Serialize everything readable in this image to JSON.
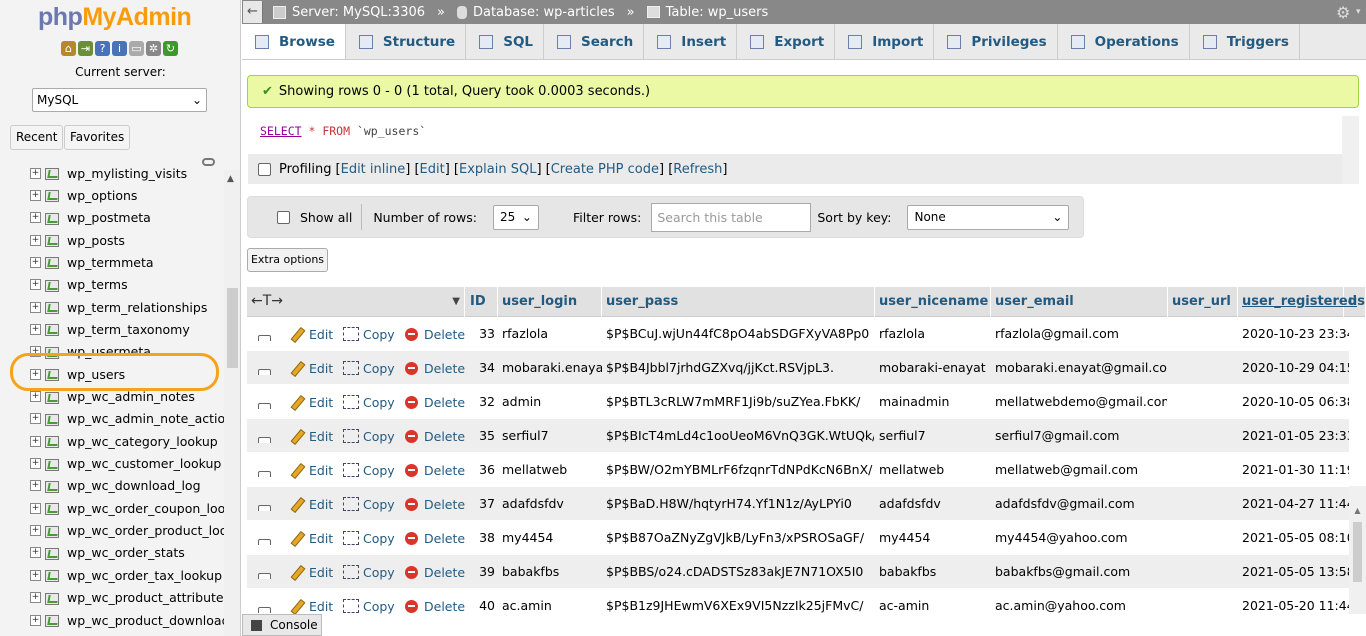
{
  "sidebar": {
    "logo_php": "php",
    "logo_my": "MyAdmin",
    "current_server_label": "Current server:",
    "server_select": "MySQL",
    "recent": "Recent",
    "favorites": "Favorites",
    "tables": [
      "wp_mylisting_visits",
      "wp_options",
      "wp_postmeta",
      "wp_posts",
      "wp_termmeta",
      "wp_terms",
      "wp_term_relationships",
      "wp_term_taxonomy",
      "wp_usermeta",
      "wp_users",
      "wp_wc_admin_notes",
      "wp_wc_admin_note_action",
      "wp_wc_category_lookup",
      "wp_wc_customer_lookup",
      "wp_wc_download_log",
      "wp_wc_order_coupon_look",
      "wp_wc_order_product_look",
      "wp_wc_order_stats",
      "wp_wc_order_tax_lookup",
      "wp_wc_product_attributes_",
      "wp_wc_product_download_"
    ]
  },
  "breadcrumb": {
    "server": "Server: MySQL:3306",
    "database": "Database: wp-articles",
    "table": "Table: wp_users"
  },
  "tabs": [
    "Browse",
    "Structure",
    "SQL",
    "Search",
    "Insert",
    "Export",
    "Import",
    "Privileges",
    "Operations",
    "Triggers"
  ],
  "success_message": "Showing rows 0 - 0 (1 total, Query took 0.0003 seconds.)",
  "sql": {
    "keyword": "SELECT",
    "rest": " * FROM ",
    "table": "`wp_users`"
  },
  "profiling": {
    "label": "Profiling",
    "edit_inline": "Edit inline",
    "edit": "Edit",
    "explain": "Explain SQL",
    "create_php": "Create PHP code",
    "refresh": "Refresh"
  },
  "navbar": {
    "show_all": "Show all",
    "num_rows_label": "Number of rows:",
    "num_rows_value": "25",
    "filter_label": "Filter rows:",
    "filter_placeholder": "Search this table",
    "sort_label": "Sort by key:",
    "sort_value": "None"
  },
  "extra_options": "Extra options",
  "columns": [
    "ID",
    "user_login",
    "user_pass",
    "user_nicename",
    "user_email",
    "user_url",
    "user_registered",
    "user_"
  ],
  "column_arrows": "←T→",
  "actions": {
    "edit": "Edit",
    "copy": "Copy",
    "delete": "Delete"
  },
  "rows": [
    {
      "id": "33",
      "login": "rfazlola",
      "pass": "$P$BCuJ.wjUn44fC8pO4abSDGFXyVA8Pp0",
      "nicename": "rfazlola",
      "email": "rfazlola@gmail.com",
      "url": "",
      "registered": "2020-10-23 23:34:0"
    },
    {
      "id": "34",
      "login": "mobaraki.enayat",
      "pass": "$P$B4Jbbl7jrhdGZXvq/jjKct.RSVjpL3.",
      "nicename": "mobaraki-enayat",
      "email": "mobaraki.enayat@gmail.com",
      "url": "",
      "registered": "2020-10-29 04:15:5"
    },
    {
      "id": "32",
      "login": "admin",
      "pass": "$P$BTL3cRLW7mMRF1Ji9b/suZYea.FbKK/",
      "nicename": "mainadmin",
      "email": "mellatwebdemo@gmail.com",
      "url": "",
      "registered": "2020-10-05 06:38:3"
    },
    {
      "id": "35",
      "login": "serfiul7",
      "pass": "$P$BIcT4mLd4c1ooUeoM6VnQ3GK.WtUQk/",
      "nicename": "serfiul7",
      "email": "serfiul7@gmail.com",
      "url": "",
      "registered": "2021-01-05 23:33:2"
    },
    {
      "id": "36",
      "login": "mellatweb",
      "pass": "$P$BW/O2mYBMLrF6fzqnrTdNPdKcN6BnX/",
      "nicename": "mellatweb",
      "email": "mellatweb@gmail.com",
      "url": "",
      "registered": "2021-01-30 11:19:2"
    },
    {
      "id": "37",
      "login": "adafdsfdv",
      "pass": "$P$BaD.H8W/hqtyrH74.Yf1N1z/AyLPYi0",
      "nicename": "adafdsfdv",
      "email": "adafdsfdv@gmail.com",
      "url": "",
      "registered": "2021-04-27 11:44:3"
    },
    {
      "id": "38",
      "login": "my4454",
      "pass": "$P$B87OaZNyZgVJkB/LyFn3/xPSROSaGF/",
      "nicename": "my4454",
      "email": "my4454@yahoo.com",
      "url": "",
      "registered": "2021-05-05 08:10:1"
    },
    {
      "id": "39",
      "login": "babakfbs",
      "pass": "$P$BBS/o24.cDADSTSz83akJE7N71OX5I0",
      "nicename": "babakfbs",
      "email": "babakfbs@gmail.com",
      "url": "",
      "registered": "2021-05-05 13:58:3"
    },
    {
      "id": "40",
      "login": "ac.amin",
      "pass": "$P$B1z9JHEwmV6XEx9VI5NzzIk25jFMvC/",
      "nicename": "ac-amin",
      "email": "ac.amin@yahoo.com",
      "url": "",
      "registered": "2021-05-20 11:44:1"
    }
  ],
  "console": "Console",
  "colors": {
    "link": "#235a81",
    "highlight": "#f5a31a",
    "success_bg": "#ebf8a4"
  }
}
